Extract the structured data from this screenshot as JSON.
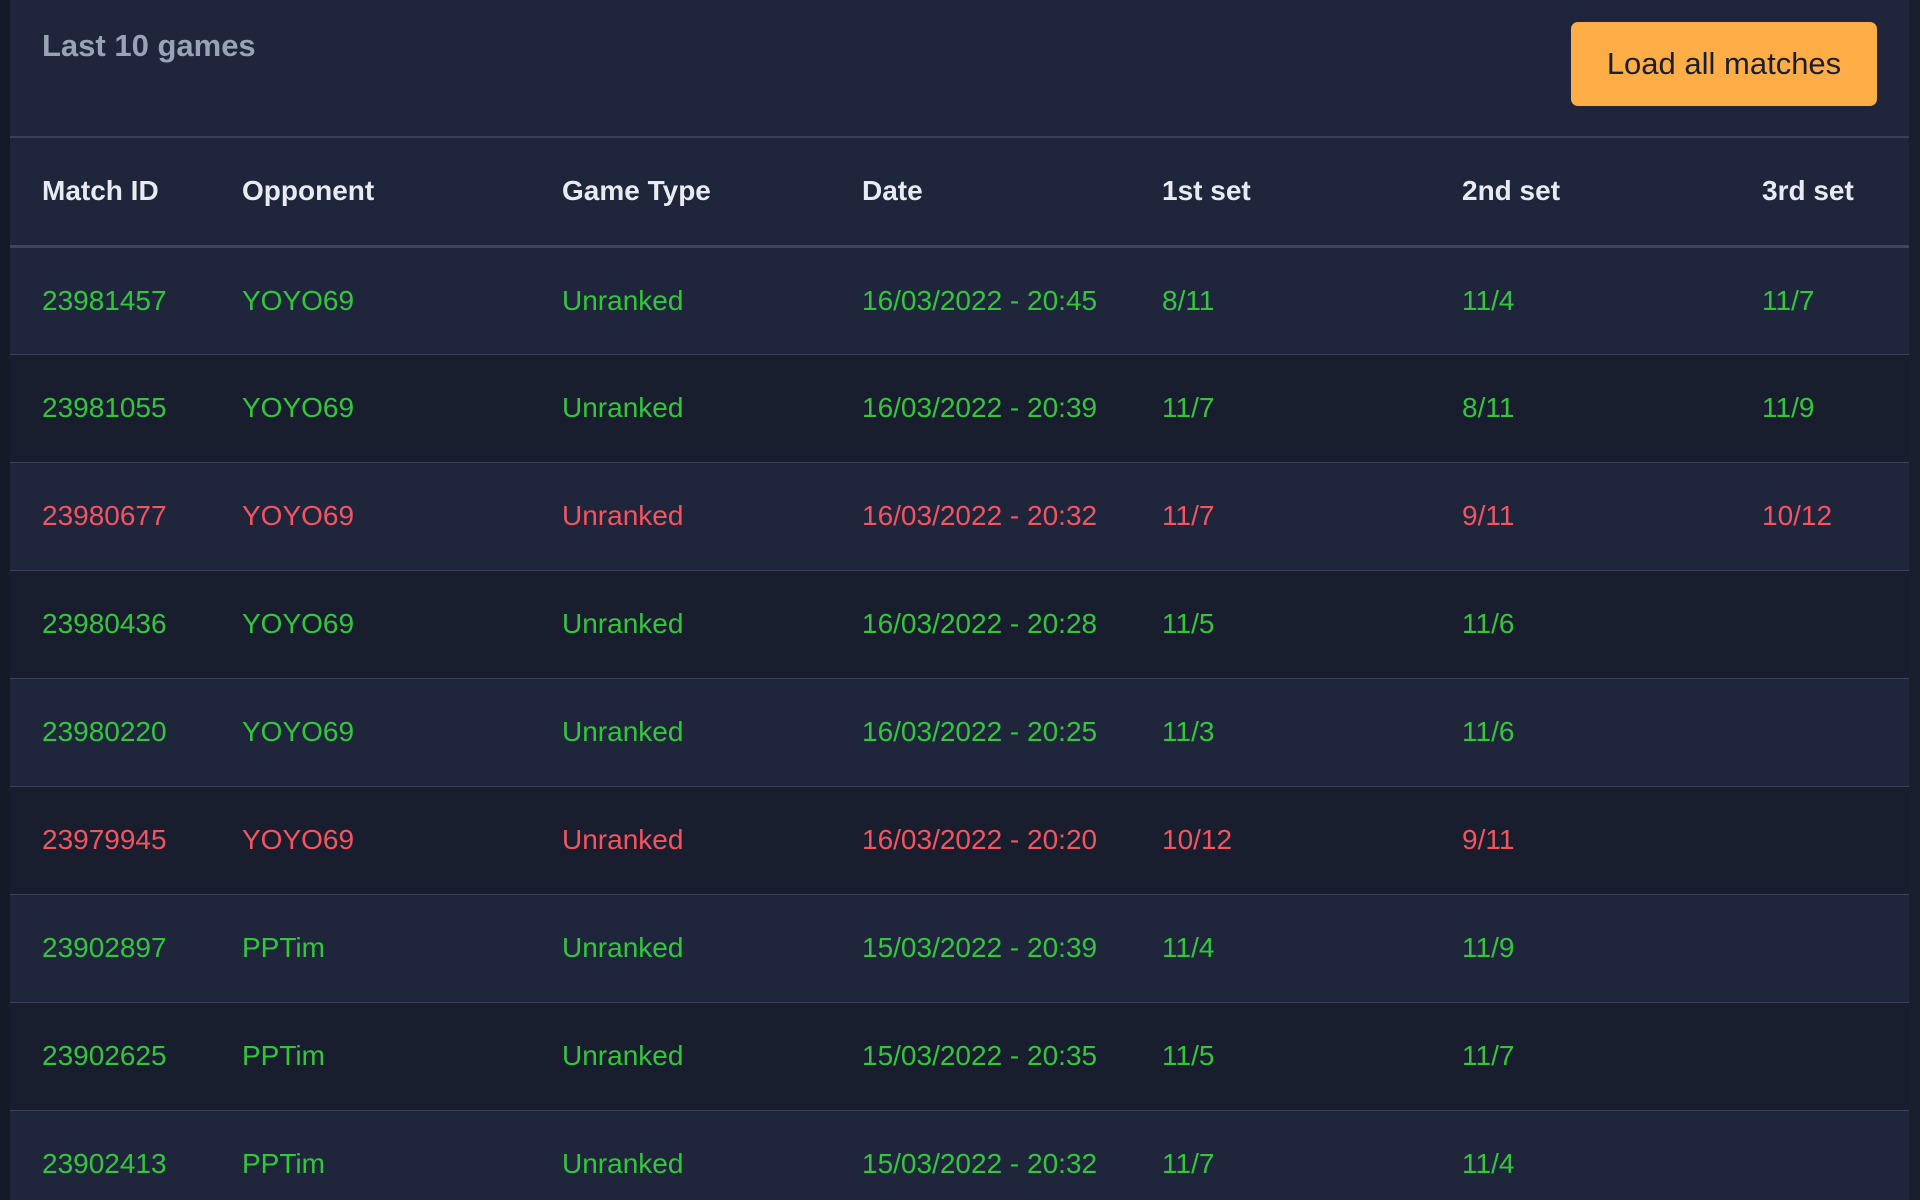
{
  "header": {
    "title": "Last 10 games",
    "load_button_label": "Load all matches"
  },
  "colors": {
    "win": "#33c63d",
    "loss": "#f4535f",
    "button": "#ffad47",
    "panel": "#1f263c"
  },
  "table": {
    "columns": [
      "Match ID",
      "Opponent",
      "Game Type",
      "Date",
      "1st set",
      "2nd set",
      "3rd set"
    ],
    "rows": [
      {
        "result": "win",
        "match_id": "23981457",
        "opponent": "YOYO69",
        "game_type": "Unranked",
        "date": "16/03/2022 - 20:45",
        "set1": "8/11",
        "set2": "11/4",
        "set3": "11/7"
      },
      {
        "result": "win",
        "match_id": "23981055",
        "opponent": "YOYO69",
        "game_type": "Unranked",
        "date": "16/03/2022 - 20:39",
        "set1": "11/7",
        "set2": "8/11",
        "set3": "11/9"
      },
      {
        "result": "loss",
        "match_id": "23980677",
        "opponent": "YOYO69",
        "game_type": "Unranked",
        "date": "16/03/2022 - 20:32",
        "set1": "11/7",
        "set2": "9/11",
        "set3": "10/12"
      },
      {
        "result": "win",
        "match_id": "23980436",
        "opponent": "YOYO69",
        "game_type": "Unranked",
        "date": "16/03/2022 - 20:28",
        "set1": "11/5",
        "set2": "11/6",
        "set3": ""
      },
      {
        "result": "win",
        "match_id": "23980220",
        "opponent": "YOYO69",
        "game_type": "Unranked",
        "date": "16/03/2022 - 20:25",
        "set1": "11/3",
        "set2": "11/6",
        "set3": ""
      },
      {
        "result": "loss",
        "match_id": "23979945",
        "opponent": "YOYO69",
        "game_type": "Unranked",
        "date": "16/03/2022 - 20:20",
        "set1": "10/12",
        "set2": "9/11",
        "set3": ""
      },
      {
        "result": "win",
        "match_id": "23902897",
        "opponent": "PPTim",
        "game_type": "Unranked",
        "date": "15/03/2022 - 20:39",
        "set1": "11/4",
        "set2": "11/9",
        "set3": ""
      },
      {
        "result": "win",
        "match_id": "23902625",
        "opponent": "PPTim",
        "game_type": "Unranked",
        "date": "15/03/2022 - 20:35",
        "set1": "11/5",
        "set2": "11/7",
        "set3": ""
      },
      {
        "result": "win",
        "match_id": "23902413",
        "opponent": "PPTim",
        "game_type": "Unranked",
        "date": "15/03/2022 - 20:32",
        "set1": "11/7",
        "set2": "11/4",
        "set3": ""
      }
    ]
  }
}
